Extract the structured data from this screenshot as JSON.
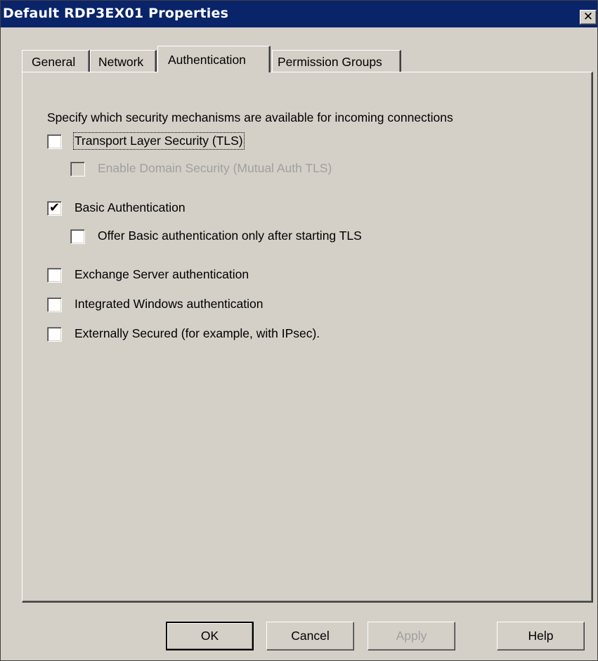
{
  "window": {
    "title": "Default RDP3EX01 Properties",
    "close_glyph": "✕"
  },
  "tabs": [
    {
      "label": "General",
      "active": false
    },
    {
      "label": "Network",
      "active": false
    },
    {
      "label": "Authentication",
      "active": true
    },
    {
      "label": "Permission Groups",
      "active": false
    }
  ],
  "auth": {
    "intro": "Specify which security mechanisms are available for incoming connections",
    "options": {
      "tls": {
        "label": "Transport Layer Security (TLS)",
        "checked": false,
        "enabled": true
      },
      "domain_security": {
        "label": "Enable Domain Security (Mutual Auth TLS)",
        "checked": false,
        "enabled": false
      },
      "basic": {
        "label": "Basic Authentication",
        "checked": true,
        "enabled": true
      },
      "basic_after_tls": {
        "label": "Offer Basic authentication only after starting TLS",
        "checked": false,
        "enabled": true
      },
      "exchange_server": {
        "label": "Exchange Server authentication",
        "checked": false,
        "enabled": true
      },
      "integrated_windows": {
        "label": "Integrated Windows authentication",
        "checked": false,
        "enabled": true
      },
      "externally_secured": {
        "label": "Externally Secured (for example, with IPsec).",
        "checked": false,
        "enabled": true
      }
    },
    "check_glyph": "✔"
  },
  "buttons": {
    "ok": "OK",
    "cancel": "Cancel",
    "apply": "Apply",
    "help": "Help"
  }
}
